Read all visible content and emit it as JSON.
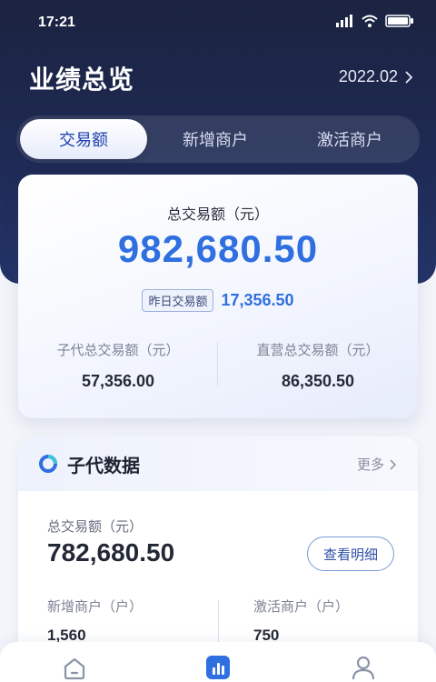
{
  "status_bar": {
    "time": "17:21"
  },
  "header": {
    "title": "业绩总览",
    "date": "2022.02"
  },
  "tabs": [
    {
      "label": "交易额",
      "active": true
    },
    {
      "label": "新增商户",
      "active": false
    },
    {
      "label": "激活商户",
      "active": false
    }
  ],
  "summary": {
    "label": "总交易额（元）",
    "value": "982,680.50",
    "yesterday_label": "昨日交易额",
    "yesterday_value": "17,356.50",
    "left_label": "子代总交易额（元）",
    "left_value": "57,356.00",
    "right_label": "直营总交易额（元）",
    "right_value": "86,350.50"
  },
  "sub_agent": {
    "title": "子代数据",
    "more": "更多",
    "total_label": "总交易额（元）",
    "total_value": "782,680.50",
    "detail_button": "查看明细",
    "new_label": "新增商户（户）",
    "new_value": "1,560",
    "active_label": "激活商户（户）",
    "active_value": "750"
  },
  "bottom_nav": [
    {
      "icon": "home-icon"
    },
    {
      "icon": "stats-icon"
    },
    {
      "icon": "profile-icon"
    }
  ],
  "colors": {
    "accent": "#2f6fe0",
    "header_bg": "#1b2340"
  }
}
